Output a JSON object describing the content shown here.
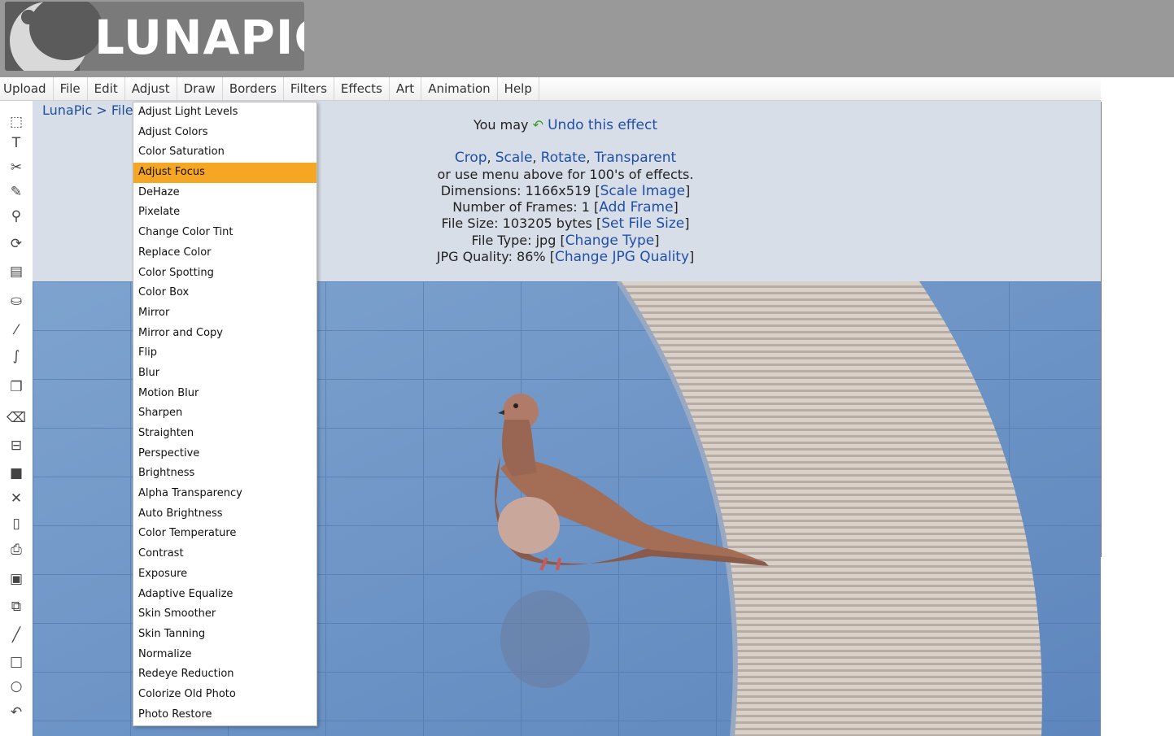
{
  "header": {
    "logo_text": "LUNAPIC"
  },
  "menubar": [
    "Upload",
    "File",
    "Edit",
    "Adjust",
    "Draw",
    "Borders",
    "Filters",
    "Effects",
    "Art",
    "Animation",
    "Help"
  ],
  "breadcrumb": {
    "home": "LunaPic",
    "sep": ">",
    "current": "File"
  },
  "info": {
    "undo_prefix": "You may",
    "undo_link": "Undo this effect",
    "quick_links": [
      "Crop",
      "Scale",
      "Rotate",
      "Transparent"
    ],
    "menu_hint": "or use menu above for 100's of effects.",
    "dimensions_label": "Dimensions: 1166x519",
    "dimensions_link": "Scale Image",
    "frames_label": "Number of Frames: 1",
    "frames_link": "Add Frame",
    "size_label": "File Size: 103205 bytes",
    "size_link": "Set File Size",
    "type_label": "File Type: jpg",
    "type_link": "Change Type",
    "quality_label": "JPG Quality: 86%",
    "quality_link": "Change JPG Quality"
  },
  "dropdown": {
    "selected": "Adjust Focus",
    "items": [
      "Adjust Light Levels",
      "Adjust Colors",
      "Color Saturation",
      "Adjust Focus",
      "DeHaze",
      "Pixelate",
      "Change Color Tint",
      "Replace Color",
      "Color Spotting",
      "Color Box",
      "Mirror",
      "Mirror and Copy",
      "Flip",
      "Blur",
      "Motion Blur",
      "Sharpen",
      "Straighten",
      "Perspective",
      "Brightness",
      "Alpha Transparency",
      "Auto Brightness",
      "Color Temperature",
      "Contrast",
      "Exposure",
      "Adaptive Equalize",
      "Skin Smoother",
      "Skin Tanning",
      "Normalize",
      "Redeye Reduction",
      "Colorize Old Photo",
      "Photo Restore"
    ]
  },
  "toolbar": [
    {
      "icon": "select-icon",
      "glyph": "⬚"
    },
    {
      "icon": "text-icon",
      "glyph": "T"
    },
    {
      "icon": "scissors-icon",
      "glyph": "✂"
    },
    {
      "icon": "pencil-icon",
      "glyph": "✎"
    },
    {
      "icon": "zoom-icon",
      "glyph": "⚲"
    },
    {
      "icon": "rotate-icon",
      "glyph": "⟳"
    },
    {
      "icon": "gradient-icon",
      "glyph": "▤"
    },
    {
      "icon": "paint-bucket-icon",
      "glyph": "⛀"
    },
    {
      "icon": "eyedropper-icon",
      "glyph": "⁄"
    },
    {
      "icon": "brush-icon",
      "glyph": "∫"
    },
    {
      "icon": "layers-icon",
      "glyph": "❐"
    },
    {
      "icon": "eraser-icon",
      "glyph": "⌫"
    },
    {
      "icon": "open-folder-icon",
      "glyph": "⊟"
    },
    {
      "icon": "save-icon",
      "glyph": "■"
    },
    {
      "icon": "close-icon",
      "glyph": "✕"
    },
    {
      "icon": "new-page-icon",
      "glyph": "▯"
    },
    {
      "icon": "print-icon",
      "glyph": "⎙"
    },
    {
      "icon": "paste-icon",
      "glyph": "▣"
    },
    {
      "icon": "copy-icon",
      "glyph": "⧉"
    },
    {
      "icon": "line-icon",
      "glyph": "╱"
    },
    {
      "icon": "rectangle-icon",
      "glyph": "□"
    },
    {
      "icon": "circle-icon",
      "glyph": "○"
    },
    {
      "icon": "undo-icon",
      "glyph": "↶"
    }
  ],
  "colors": {
    "header": "#999999",
    "content": "#d8dee8",
    "link": "#1f4fa8",
    "selected": "#f5a623"
  }
}
